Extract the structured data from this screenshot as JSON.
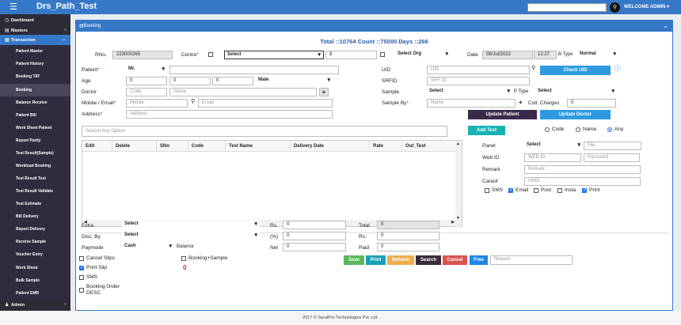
{
  "app": {
    "title": "Drs_Path_Test",
    "welcome": "WELCOME ADMIN ▾",
    "menu_icon": "hamburger-icon",
    "search_icon": "search-icon"
  },
  "sidebar": {
    "items": [
      {
        "label": "Dashboard",
        "icon": "dashboard-icon"
      },
      {
        "label": "Masters",
        "icon": "book-icon"
      },
      {
        "label": "Transaction",
        "icon": "transaction-icon"
      },
      {
        "label": "Patient Master"
      },
      {
        "label": "Patient History"
      },
      {
        "label": "Booking TAT"
      },
      {
        "label": "Booking"
      },
      {
        "label": "Balance Receive"
      },
      {
        "label": "Patient Bill"
      },
      {
        "label": "Work Sheet Patient"
      },
      {
        "label": "Report Partly"
      },
      {
        "label": "Test Result(Sample)"
      },
      {
        "label": "Workload Booking"
      },
      {
        "label": "Test Result Test"
      },
      {
        "label": "Test Result Validate"
      },
      {
        "label": "Test Estimate"
      },
      {
        "label": "Bill Delivery"
      },
      {
        "label": "Report Delivery"
      },
      {
        "label": "Receive Sample"
      },
      {
        "label": "Voucher Entry"
      },
      {
        "label": "Work Sheet"
      },
      {
        "label": "Bulk Sample"
      },
      {
        "label": "Patient EMR"
      },
      {
        "label": "Admin",
        "icon": "user-icon"
      }
    ]
  },
  "panel": {
    "title": "Booking",
    "summary": "Total ::10764 Count ::75000 Days ::266"
  },
  "row1": {
    "rno_label": "RNo.",
    "rno_value": "223000265",
    "centre_label": "Centre",
    "centre_select": "Select",
    "centre_code": "8",
    "org_select": "Select Org",
    "date_label": "Date",
    "date_value": "08/Jul/2022",
    "time_value": "12:27",
    "btype_label": "B Type",
    "btype_select": "Normal"
  },
  "patient": {
    "label": "Patient",
    "title_select": "Mr.",
    "name_value": "",
    "age_label": "Age",
    "age_y": "0",
    "age_m": "0",
    "age_d": "0",
    "gender_select": "Male",
    "doctor_label": "Doctor",
    "doctor_code_ph": "Code",
    "doctor_name_ph": "Name",
    "mobile_label": "Mobile / Email",
    "mobile_ph": "Mobile",
    "email_ph": "Email",
    "address_label": "Address",
    "address_ph": "Address"
  },
  "right": {
    "uid_label": "UID",
    "uid_ph": "UID",
    "check_uid": "Check UID",
    "srfid_label": "SRFID",
    "srfid_ph": "SRF ID",
    "sample_label": "Sample",
    "sample_select": "Select",
    "ptype_label": "P Type",
    "ptype_select": "Select",
    "sampleby_label": "Sample By",
    "sampleby_ph": "Name",
    "coll_label": "Coll. Charges",
    "coll_value": "0",
    "update_patient": "Update Patient",
    "update_doctor": "Update Doctor"
  },
  "search": {
    "placeholder": "Search Any Option",
    "add_test": "Add Test",
    "radio_code": "Code",
    "radio_name": "Name",
    "radio_any": "Any"
  },
  "grid": {
    "columns": [
      "Edit",
      "Delete",
      "SNo",
      "Code",
      "Test Name",
      "Delivery Date",
      "Rate",
      "Out_Test"
    ]
  },
  "side": {
    "panel_label": "Panel",
    "panel_select": "Select",
    "file_ph": "File",
    "webid_label": "Web ID",
    "webid_ph": "WEB ID",
    "password_ph": "Password",
    "remark_label": "Remark",
    "remark_ph": "Remark",
    "careof_label": "Careof",
    "careof_ph": "UHID",
    "sms": "SMS",
    "email": "Email",
    "post": "Post",
    "insta": "Insta",
    "print": "Print"
  },
  "bottom": {
    "extra_label": "Extra",
    "extra_select": "Select",
    "disc_label": "Disc. By",
    "disc_select": "Select",
    "paymode_label": "Paymode",
    "paymode_select": "Cash",
    "balance_label": "Balance",
    "rs_label": "Rs.",
    "rs_value": "0",
    "pct_label": "(%)",
    "pct_value": "0",
    "net_label": "Net",
    "net_value": "0",
    "total_label": "Total",
    "total_value": "0",
    "rs2_label": "Rs.",
    "rs2_value": "0",
    "paid_label": "Paid",
    "paid_value": "0"
  },
  "options": {
    "cancel_slips": "Cancel Slips",
    "print_slip": "Print Slip",
    "sms": "SMS",
    "booking_order": "Booking Order DESC",
    "booking_sample": "Booking+Sample",
    "counter": "0"
  },
  "actions": {
    "save": "Save",
    "print": "Print",
    "refresh": "Refresh",
    "search": "Search",
    "cancel": "Cancel",
    "free": "Free",
    "reason_ph": "Reason"
  },
  "colors": {
    "primary": "#3678c8",
    "sidebar": "#2d2b36",
    "save": "#5cb85c",
    "print": "#17a2b8",
    "refresh": "#f0ad4e",
    "search": "#3a2a3a",
    "cancel": "#d9534f",
    "free": "#1e88e5"
  },
  "footer": "2017 © SaralPro Technologies Pvt. Ltd."
}
